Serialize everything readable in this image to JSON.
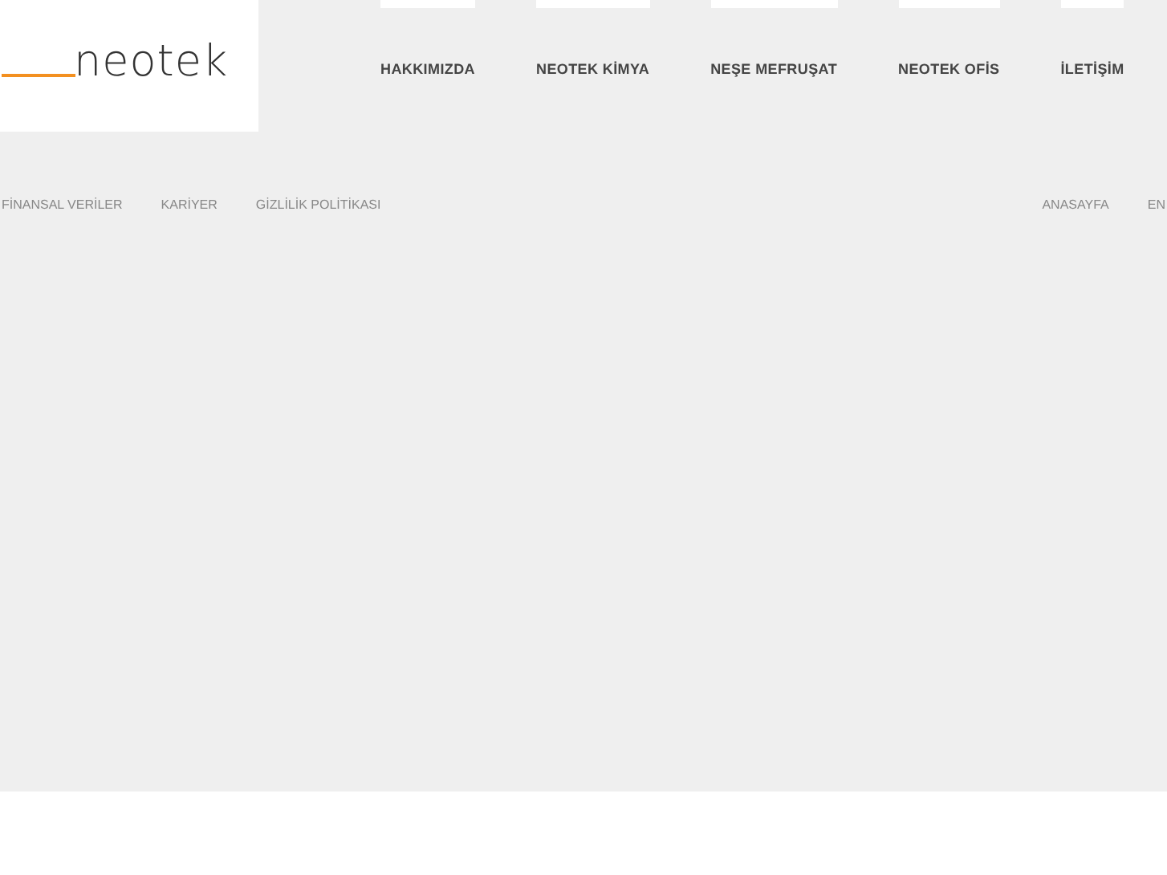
{
  "logo": {
    "text": "neotek"
  },
  "nav": [
    {
      "label": "HAKKIMIZDA"
    },
    {
      "label": "NEOTEK KİMYA"
    },
    {
      "label": "NEŞE MEFRUŞAT"
    },
    {
      "label": "NEOTEK OFİS"
    },
    {
      "label": "İLETİŞİM"
    }
  ],
  "footer_links_left": [
    "FİNANSAL VERİLER",
    "KARİYER",
    "GİZLİLİK POLİTİKASI"
  ],
  "footer_links_right": [
    "ANASAYFA",
    "EN"
  ]
}
